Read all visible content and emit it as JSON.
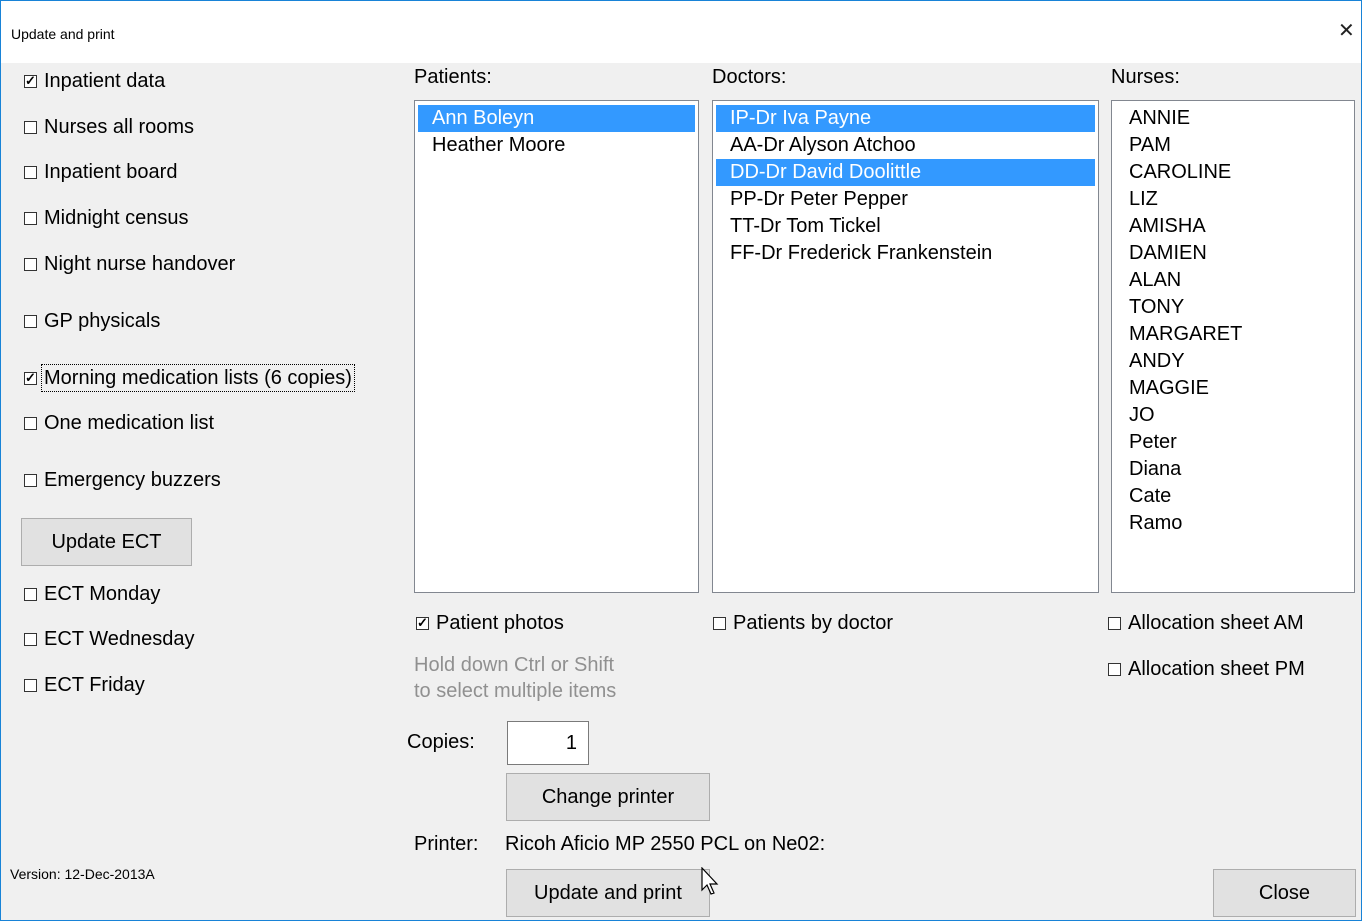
{
  "window": {
    "title": "Update and print",
    "close_glyph": "✕"
  },
  "reports": [
    {
      "label": "Inpatient data",
      "checked": true
    },
    {
      "label": "Nurses all rooms",
      "checked": false
    },
    {
      "label": "Inpatient board",
      "checked": false
    },
    {
      "label": "Midnight census",
      "checked": false
    },
    {
      "label": "Night nurse handover",
      "checked": false
    },
    {
      "label": "GP physicals",
      "checked": false
    },
    {
      "label": "Morning medication lists (6 copies)",
      "checked": true,
      "focused": true
    },
    {
      "label": "One medication list",
      "checked": false
    },
    {
      "label": "Emergency buzzers",
      "checked": false
    }
  ],
  "update_ect_button": "Update ECT",
  "ect_days": [
    {
      "label": "ECT Monday",
      "checked": false
    },
    {
      "label": "ECT Wednesday",
      "checked": false
    },
    {
      "label": "ECT Friday",
      "checked": false
    }
  ],
  "patients": {
    "label": "Patients:",
    "items": [
      {
        "name": "Ann Boleyn",
        "selected": true
      },
      {
        "name": "Heather Moore",
        "selected": false
      }
    ]
  },
  "doctors": {
    "label": "Doctors:",
    "items": [
      {
        "name": "IP-Dr Iva Payne",
        "selected": true
      },
      {
        "name": "AA-Dr Alyson Atchoo",
        "selected": false
      },
      {
        "name": "DD-Dr David Doolittle",
        "selected": true
      },
      {
        "name": "PP-Dr Peter Pepper",
        "selected": false
      },
      {
        "name": "TT-Dr Tom Tickel",
        "selected": false
      },
      {
        "name": "FF-Dr Frederick Frankenstein",
        "selected": false
      }
    ]
  },
  "nurses": {
    "label": "Nurses:",
    "items": [
      "ANNIE",
      "PAM",
      "CAROLINE",
      "LIZ",
      "AMISHA",
      "DAMIEN",
      "ALAN",
      "TONY",
      "MARGARET",
      "ANDY",
      "MAGGIE",
      "JO",
      "Peter",
      "Diana",
      "Cate",
      "Ramo"
    ]
  },
  "patient_photos": {
    "label": "Patient photos",
    "checked": true
  },
  "patients_by_doctor": {
    "label": "Patients by doctor",
    "checked": false
  },
  "allocation_am": {
    "label": "Allocation sheet AM",
    "checked": false
  },
  "allocation_pm": {
    "label": "Allocation sheet PM",
    "checked": false
  },
  "hint_line1": "Hold down Ctrl or Shift",
  "hint_line2": "to select multiple items",
  "copies": {
    "label": "Copies:",
    "value": "1"
  },
  "change_printer_button": "Change printer",
  "printer": {
    "label": "Printer:",
    "name": "Ricoh Aficio MP 2550 PCL on Ne02:"
  },
  "update_print_button": "Update and print",
  "close_button": "Close",
  "version": "Version: 12-Dec-2013A"
}
